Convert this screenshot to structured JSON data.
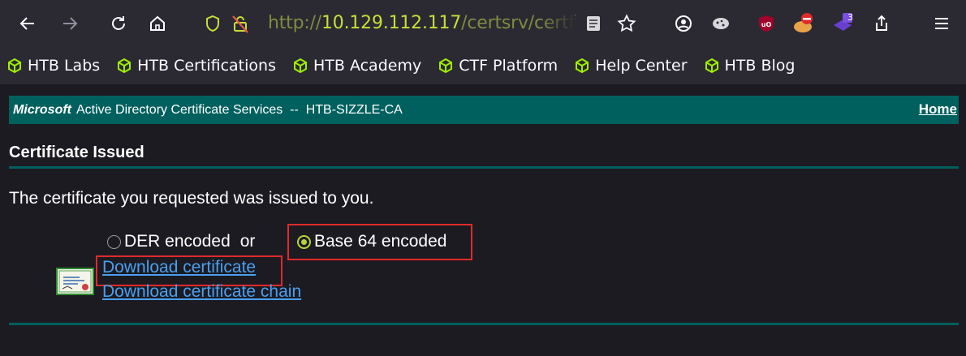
{
  "browser": {
    "back_icon": "arrow-left",
    "forward_icon": "arrow-right",
    "reload_icon": "reload",
    "home_icon": "home",
    "url": {
      "protocol": "http://",
      "host": "10.129.112.117",
      "path": "/certsrv/certfnsh"
    },
    "colors": {
      "toolbar": "#2b2a33",
      "url_host": "#c8de36"
    },
    "extension_badge": "3"
  },
  "bookmarks": [
    {
      "label": "HTB Labs"
    },
    {
      "label": "HTB Certifications"
    },
    {
      "label": "HTB Academy"
    },
    {
      "label": "CTF Platform"
    },
    {
      "label": "Help Center"
    },
    {
      "label": "HTB Blog"
    }
  ],
  "page": {
    "header": {
      "brand": "Microsoft",
      "service": "Active Directory Certificate Services  --  HTB-SIZZLE-CA",
      "home_link": "Home"
    },
    "title": "Certificate Issued",
    "message": "The certificate you requested was issued to you.",
    "encoding": {
      "der_label": "DER encoded",
      "or_label": "or",
      "base64_label": "Base 64 encoded",
      "selected": "Base 64 encoded"
    },
    "links": {
      "download_cert": "Download certificate",
      "download_chain": "Download certificate chain"
    },
    "colors": {
      "accent": "#00605e",
      "link": "#4a9ff0",
      "highlight_box": "#e02a2a"
    }
  }
}
